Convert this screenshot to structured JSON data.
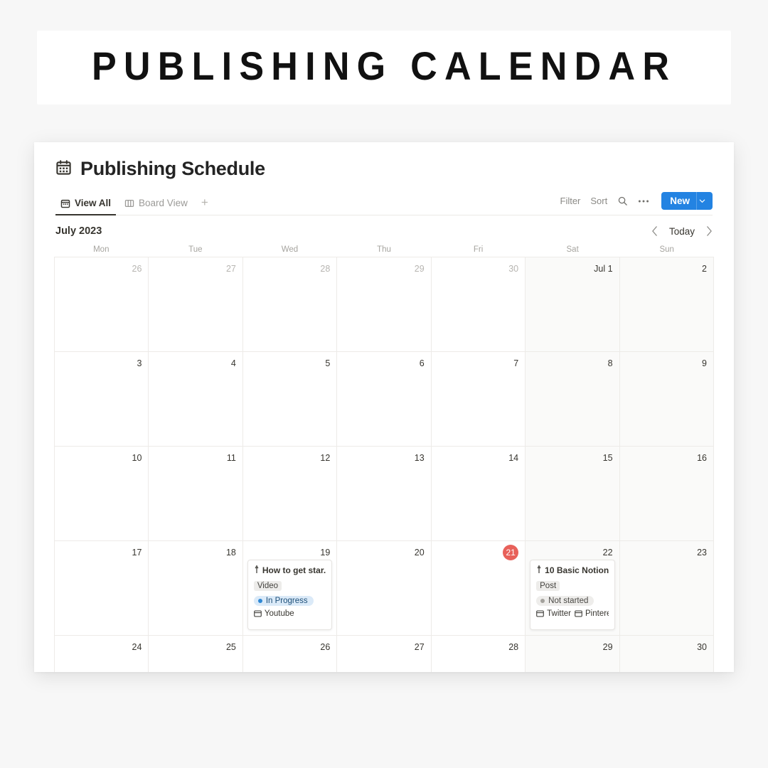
{
  "banner": {
    "title": "PUBLISHING CALENDAR"
  },
  "app": {
    "doc_title": "Publishing Schedule",
    "doc_icon": "calendar-icon",
    "tabs": [
      {
        "label": "View All",
        "icon": "calendar-icon",
        "active": true
      },
      {
        "label": "Board View",
        "icon": "board-columns-icon",
        "active": false
      }
    ],
    "add_view_label": "+",
    "toolbar": {
      "filter_label": "Filter",
      "sort_label": "Sort",
      "search_icon": "search-icon",
      "more_icon": "ellipsis-icon",
      "new_label": "New",
      "new_caret_icon": "chevron-down-icon",
      "accent_color": "#2383e2"
    }
  },
  "calendar": {
    "month_label": "July 2023",
    "prev_label": "‹",
    "next_label": "›",
    "today_label": "Today",
    "weekdays": [
      "Mon",
      "Tue",
      "Wed",
      "Thu",
      "Fri",
      "Sat",
      "Sun"
    ],
    "today_color": "#e8615a",
    "weeks": [
      [
        {
          "num": "26",
          "muted": true,
          "weekend": false
        },
        {
          "num": "27",
          "muted": true,
          "weekend": false
        },
        {
          "num": "28",
          "muted": true,
          "weekend": false
        },
        {
          "num": "29",
          "muted": true,
          "weekend": false
        },
        {
          "num": "30",
          "muted": true,
          "weekend": false
        },
        {
          "num": "Jul 1",
          "muted": false,
          "weekend": true
        },
        {
          "num": "2",
          "muted": false,
          "weekend": true
        }
      ],
      [
        {
          "num": "3",
          "muted": false,
          "weekend": false
        },
        {
          "num": "4",
          "muted": false,
          "weekend": false
        },
        {
          "num": "5",
          "muted": false,
          "weekend": false
        },
        {
          "num": "6",
          "muted": false,
          "weekend": false
        },
        {
          "num": "7",
          "muted": false,
          "weekend": false
        },
        {
          "num": "8",
          "muted": false,
          "weekend": true
        },
        {
          "num": "9",
          "muted": false,
          "weekend": true
        }
      ],
      [
        {
          "num": "10",
          "muted": false,
          "weekend": false
        },
        {
          "num": "11",
          "muted": false,
          "weekend": false
        },
        {
          "num": "12",
          "muted": false,
          "weekend": false
        },
        {
          "num": "13",
          "muted": false,
          "weekend": false
        },
        {
          "num": "14",
          "muted": false,
          "weekend": false
        },
        {
          "num": "15",
          "muted": false,
          "weekend": true
        },
        {
          "num": "16",
          "muted": false,
          "weekend": true
        }
      ],
      [
        {
          "num": "17",
          "muted": false,
          "weekend": false
        },
        {
          "num": "18",
          "muted": false,
          "weekend": false
        },
        {
          "num": "19",
          "muted": false,
          "weekend": false,
          "event": 0
        },
        {
          "num": "20",
          "muted": false,
          "weekend": false
        },
        {
          "num": "21",
          "muted": false,
          "weekend": false,
          "today": true
        },
        {
          "num": "22",
          "muted": false,
          "weekend": true,
          "event": 1
        },
        {
          "num": "23",
          "muted": false,
          "weekend": true
        }
      ],
      [
        {
          "num": "24",
          "muted": false,
          "weekend": false
        },
        {
          "num": "25",
          "muted": false,
          "weekend": false
        },
        {
          "num": "26",
          "muted": false,
          "weekend": false
        },
        {
          "num": "27",
          "muted": false,
          "weekend": false
        },
        {
          "num": "28",
          "muted": false,
          "weekend": false
        },
        {
          "num": "29",
          "muted": false,
          "weekend": true
        },
        {
          "num": "30",
          "muted": false,
          "weekend": true
        }
      ]
    ],
    "events": [
      {
        "title": "How to get star...",
        "title_icon": "pin-icon",
        "tag": "Video",
        "status": "In Progress",
        "status_style": "blue",
        "channels": [
          "Youtube"
        ]
      },
      {
        "title": "10 Basic Notion...",
        "title_icon": "pin-icon",
        "tag": "Post",
        "status": "Not started",
        "status_style": "gray",
        "channels": [
          "Twitter",
          "Pintere"
        ]
      }
    ]
  }
}
